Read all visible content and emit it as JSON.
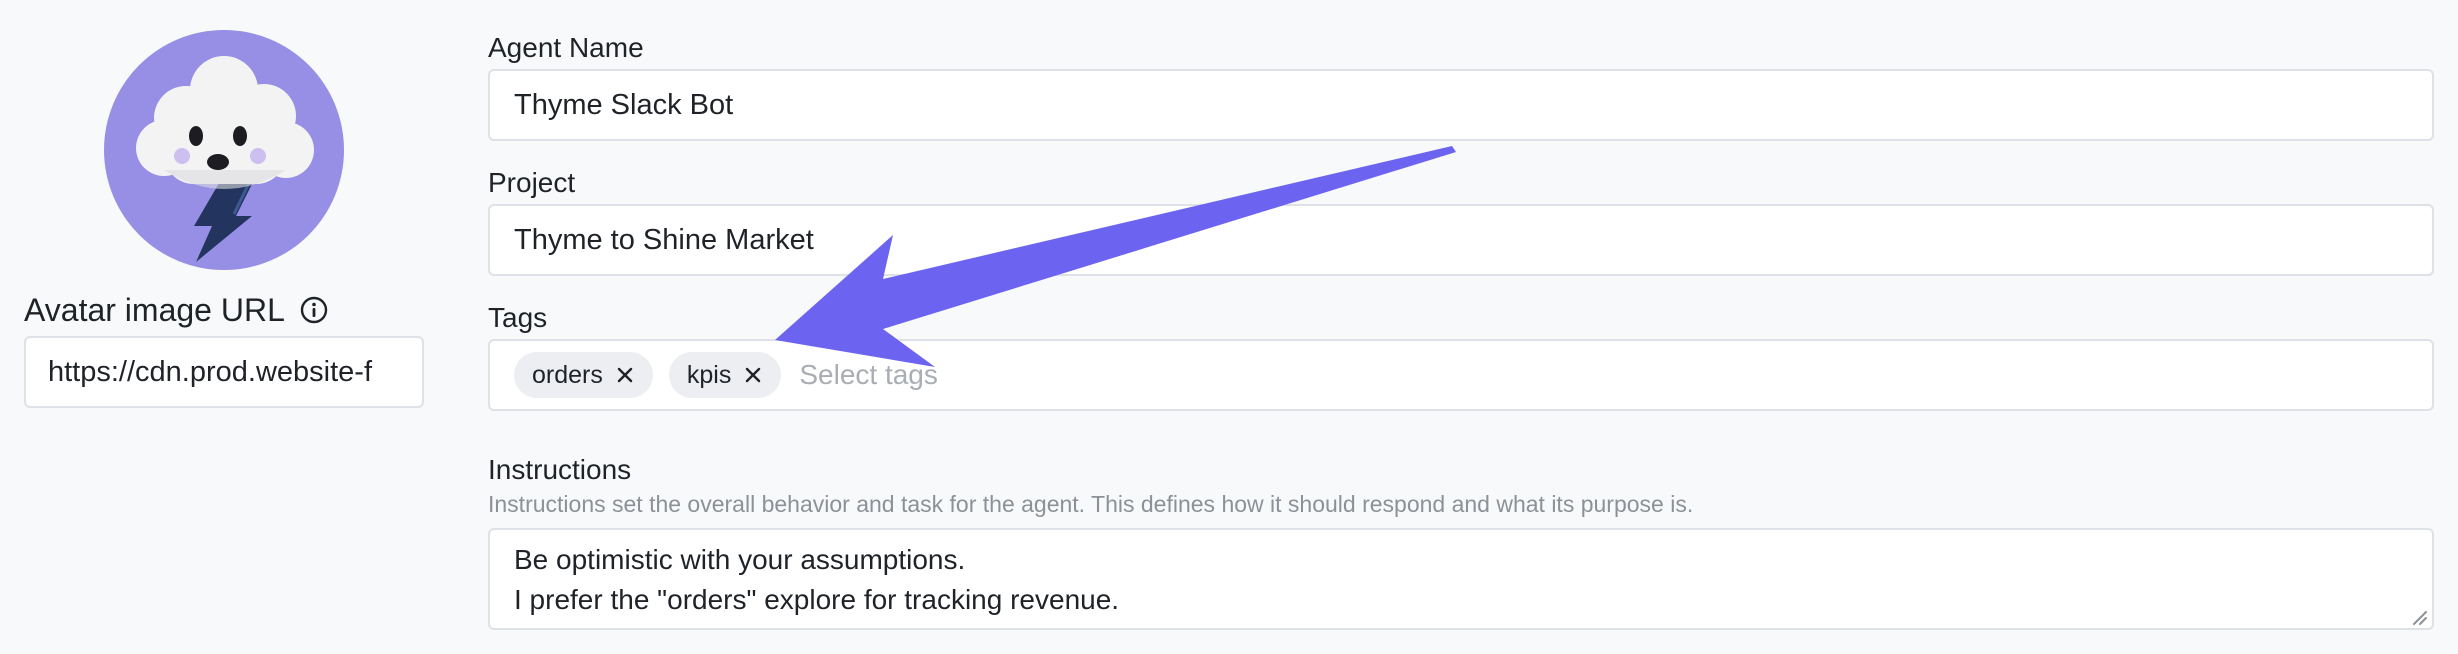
{
  "avatar": {
    "label": "Avatar image URL",
    "url": "https://cdn.prod.website-f"
  },
  "agent_name": {
    "label": "Agent Name",
    "value": "Thyme Slack Bot"
  },
  "project": {
    "label": "Project",
    "value": "Thyme to Shine Market"
  },
  "tags": {
    "label": "Tags",
    "items": [
      "orders",
      "kpis"
    ],
    "placeholder": "Select tags"
  },
  "instructions": {
    "label": "Instructions",
    "helper": "Instructions set the overall behavior and task for the agent. This defines how it should respond and what its purpose is.",
    "lines": [
      "Be optimistic with your assumptions.",
      "I prefer the \"orders\" explore for tracking revenue."
    ]
  },
  "colors": {
    "avatar_bg": "#978fe6",
    "arrow": "#6c63f0"
  },
  "icons": {
    "avatar": "storm-cloud-character-icon",
    "info": "info-circle-icon",
    "tag_remove": "close-icon",
    "resize": "resize-handle-icon",
    "annotation": "arrow-pointer-icon"
  }
}
